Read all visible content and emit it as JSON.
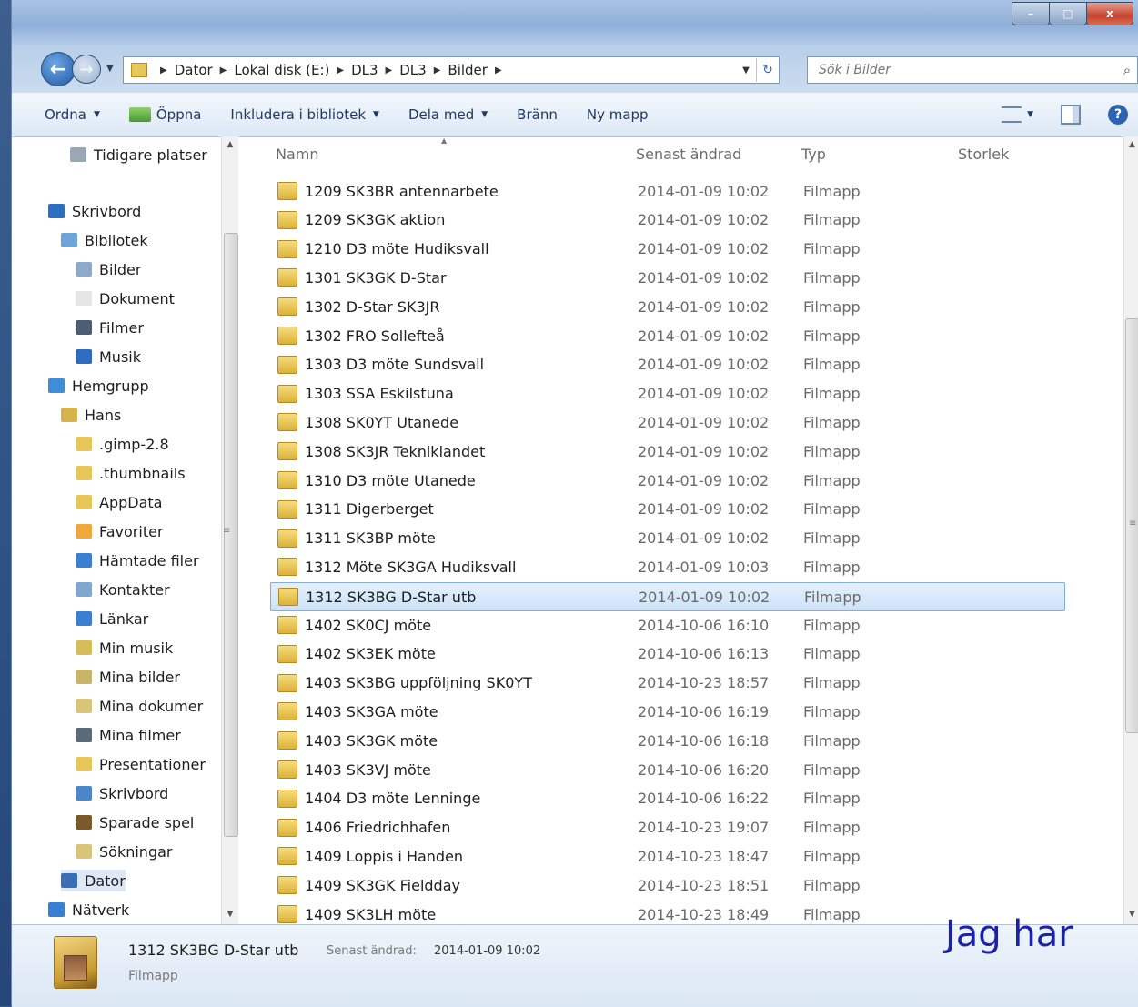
{
  "titlebar": {
    "buttons": [
      "–",
      "□",
      "x"
    ]
  },
  "address": {
    "crumbs": [
      "Dator",
      "Lokal disk (E:)",
      "DL3",
      "DL3",
      "Bilder"
    ],
    "search_placeholder": "Sök i Bilder"
  },
  "toolbar": {
    "organize": "Ordna",
    "open": "Öppna",
    "include": "Inkludera i bibliotek",
    "share": "Dela med",
    "burn": "Bränn",
    "new_folder": "Ny mapp"
  },
  "nav": {
    "items": [
      {
        "label": "Tidigare platser",
        "icon": "recent-places-icon",
        "color": "#9aa7b5"
      },
      {
        "label": "Skrivbord",
        "icon": "desktop-icon",
        "color": "#2d6fbf"
      },
      {
        "label": "Bibliotek",
        "icon": "libraries-icon",
        "color": "#6ca3d9"
      },
      {
        "label": "Bilder",
        "icon": "pictures-icon",
        "color": "#8eaac8"
      },
      {
        "label": "Dokument",
        "icon": "documents-icon",
        "color": "#e6e6e6"
      },
      {
        "label": "Filmer",
        "icon": "videos-icon",
        "color": "#4d5e73"
      },
      {
        "label": "Musik",
        "icon": "music-icon",
        "color": "#2f6bc0"
      },
      {
        "label": "Hemgrupp",
        "icon": "homegroup-icon",
        "color": "#3e8ed6"
      },
      {
        "label": "Hans",
        "icon": "user-folder-icon",
        "color": "#d6b24a"
      },
      {
        "label": ".gimp-2.8",
        "icon": "folder-icon",
        "color": "#e7c75a"
      },
      {
        "label": ".thumbnails",
        "icon": "folder-icon",
        "color": "#e7c75a"
      },
      {
        "label": "AppData",
        "icon": "folder-icon",
        "color": "#e7c75a"
      },
      {
        "label": "Favoriter",
        "icon": "favorites-icon",
        "color": "#f0a83a"
      },
      {
        "label": "Hämtade filer",
        "icon": "downloads-icon",
        "color": "#3b7fd1"
      },
      {
        "label": "Kontakter",
        "icon": "contacts-icon",
        "color": "#7fa7cf"
      },
      {
        "label": "Länkar",
        "icon": "links-icon",
        "color": "#3b7fd1"
      },
      {
        "label": "Min musik",
        "icon": "my-music-icon",
        "color": "#d7bd5a"
      },
      {
        "label": "Mina bilder",
        "icon": "my-pictures-icon",
        "color": "#c9b56a"
      },
      {
        "label": "Mina dokumer",
        "icon": "my-documents-icon",
        "color": "#d9c57a"
      },
      {
        "label": "Mina filmer",
        "icon": "my-videos-icon",
        "color": "#5a6a7a"
      },
      {
        "label": "Presentationer",
        "icon": "folder-icon",
        "color": "#e7c75a"
      },
      {
        "label": "Skrivbord",
        "icon": "desktop-folder-icon",
        "color": "#4a86c8"
      },
      {
        "label": "Sparade spel",
        "icon": "saved-games-icon",
        "color": "#7a5a2a"
      },
      {
        "label": "Sökningar",
        "icon": "searches-icon",
        "color": "#d9c57a"
      },
      {
        "label": "Dator",
        "icon": "computer-icon",
        "color": "#3a6fb5"
      },
      {
        "label": "Nätverk",
        "icon": "network-icon",
        "color": "#3b7fd1"
      }
    ]
  },
  "columns": {
    "name": "Namn",
    "modified": "Senast ändrad",
    "type": "Typ",
    "size": "Storlek"
  },
  "files": [
    {
      "name": "1209 SK3BR antennarbete",
      "date": "2014-01-09 10:02",
      "type": "Filmapp"
    },
    {
      "name": "1209 SK3GK aktion",
      "date": "2014-01-09 10:02",
      "type": "Filmapp"
    },
    {
      "name": "1210 D3 möte Hudiksvall",
      "date": "2014-01-09 10:02",
      "type": "Filmapp"
    },
    {
      "name": "1301 SK3GK D-Star",
      "date": "2014-01-09 10:02",
      "type": "Filmapp"
    },
    {
      "name": "1302 D-Star SK3JR",
      "date": "2014-01-09 10:02",
      "type": "Filmapp"
    },
    {
      "name": "1302 FRO Sollefteå",
      "date": "2014-01-09 10:02",
      "type": "Filmapp"
    },
    {
      "name": "1303 D3 möte Sundsvall",
      "date": "2014-01-09 10:02",
      "type": "Filmapp"
    },
    {
      "name": "1303 SSA Eskilstuna",
      "date": "2014-01-09 10:02",
      "type": "Filmapp"
    },
    {
      "name": "1308 SK0YT Utanede",
      "date": "2014-01-09 10:02",
      "type": "Filmapp"
    },
    {
      "name": "1308 SK3JR Tekniklandet",
      "date": "2014-01-09 10:02",
      "type": "Filmapp"
    },
    {
      "name": "1310 D3 möte Utanede",
      "date": "2014-01-09 10:02",
      "type": "Filmapp"
    },
    {
      "name": "1311 Digerberget",
      "date": "2014-01-09 10:02",
      "type": "Filmapp"
    },
    {
      "name": "1311 SK3BP möte",
      "date": "2014-01-09 10:02",
      "type": "Filmapp"
    },
    {
      "name": "1312 Möte SK3GA Hudiksvall",
      "date": "2014-01-09 10:03",
      "type": "Filmapp"
    },
    {
      "name": "1312 SK3BG D-Star utb",
      "date": "2014-01-09 10:02",
      "type": "Filmapp",
      "selected": true
    },
    {
      "name": "1402 SK0CJ möte",
      "date": "2014-10-06 16:10",
      "type": "Filmapp"
    },
    {
      "name": "1402 SK3EK möte",
      "date": "2014-10-06 16:13",
      "type": "Filmapp"
    },
    {
      "name": "1403 SK3BG uppföljning SK0YT",
      "date": "2014-10-23 18:57",
      "type": "Filmapp"
    },
    {
      "name": "1403 SK3GA möte",
      "date": "2014-10-06 16:19",
      "type": "Filmapp"
    },
    {
      "name": "1403 SK3GK möte",
      "date": "2014-10-06 16:18",
      "type": "Filmapp"
    },
    {
      "name": "1403 SK3VJ möte",
      "date": "2014-10-06 16:20",
      "type": "Filmapp"
    },
    {
      "name": "1404 D3 möte Lenninge",
      "date": "2014-10-06 16:22",
      "type": "Filmapp"
    },
    {
      "name": "1406 Friedrichhafen",
      "date": "2014-10-23 19:07",
      "type": "Filmapp"
    },
    {
      "name": "1409 Loppis i Handen",
      "date": "2014-10-23 18:47",
      "type": "Filmapp"
    },
    {
      "name": "1409 SK3GK Fieldday",
      "date": "2014-10-23 18:51",
      "type": "Filmapp"
    },
    {
      "name": "1409 SK3LH möte",
      "date": "2014-10-23 18:49",
      "type": "Filmapp"
    }
  ],
  "details": {
    "name": "1312 SK3BG D-Star utb",
    "modified_label": "Senast ändrad:",
    "modified": "2014-01-09 10:02",
    "type": "Filmapp"
  },
  "overlay_text": "Jag har"
}
